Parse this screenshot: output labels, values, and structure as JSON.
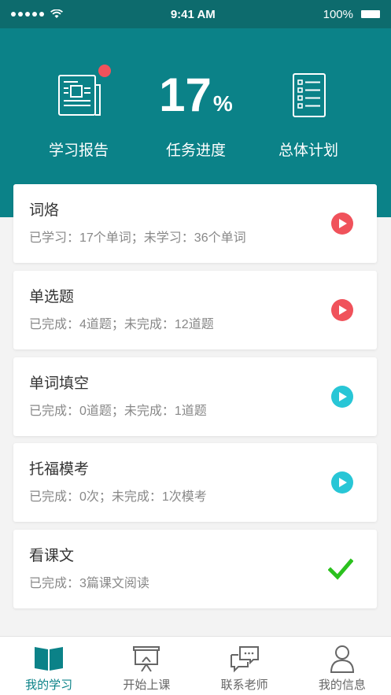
{
  "status": {
    "time": "9:41 AM",
    "battery": "100%"
  },
  "header": {
    "report_label": "学习报告",
    "progress_value": "17",
    "progress_unit": "%",
    "progress_label": "任务进度",
    "plan_label": "总体计划"
  },
  "cards": [
    {
      "title": "词烙",
      "subtitle": "已学习：17个单词；未学习：36个单词",
      "action": "play",
      "color": "#f0525b"
    },
    {
      "title": "单选题",
      "subtitle": "已完成：4道题；未完成：12道题",
      "action": "play",
      "color": "#f0525b"
    },
    {
      "title": "单词填空",
      "subtitle": "已完成：0道题；未完成：1道题",
      "action": "play",
      "color": "#28c6d6"
    },
    {
      "title": "托福模考",
      "subtitle": "已完成：0次；未完成：1次模考",
      "action": "play",
      "color": "#28c6d6"
    },
    {
      "title": "看课文",
      "subtitle": "已完成：3篇课文阅读",
      "action": "done",
      "color": "#2bc11e"
    }
  ],
  "tabs": [
    {
      "label": "我的学习",
      "icon": "book-icon",
      "active": true
    },
    {
      "label": "开始上课",
      "icon": "presentation-icon",
      "active": false
    },
    {
      "label": "联系老师",
      "icon": "chat-icon",
      "active": false
    },
    {
      "label": "我的信息",
      "icon": "user-icon",
      "active": false
    }
  ],
  "colors": {
    "accent": "#0b8288",
    "status_bar": "#0d6b6d",
    "inactive": "#666666"
  }
}
